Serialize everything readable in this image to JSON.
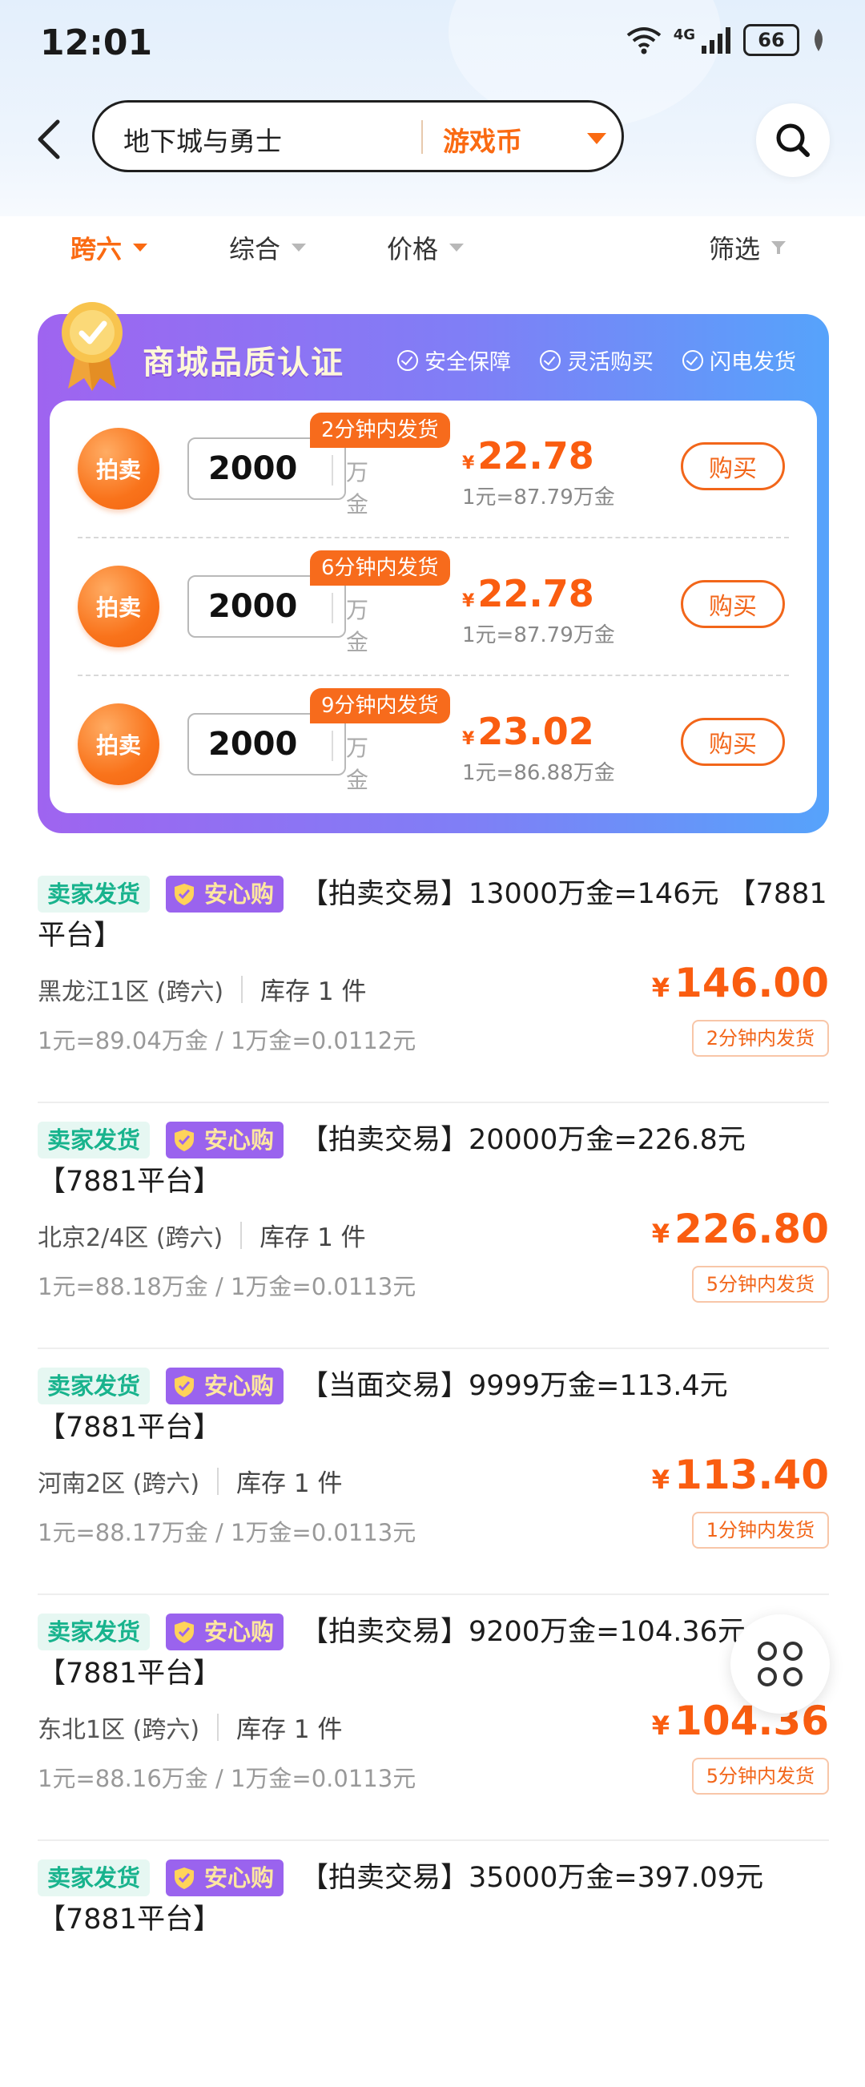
{
  "status_bar": {
    "time": "12:01",
    "network": "4G",
    "battery": "66"
  },
  "header": {
    "search_text": "地下城与勇士",
    "category": "游戏币"
  },
  "filters": [
    {
      "label": "跨六",
      "active": true
    },
    {
      "label": "综合",
      "active": false
    },
    {
      "label": "价格",
      "active": false
    },
    {
      "label": "筛选",
      "active": false
    }
  ],
  "quality": {
    "title": "商城品质认证",
    "features": [
      "安全保障",
      "灵活购买",
      "闪电发货"
    ],
    "offers": [
      {
        "badge": "拍卖",
        "quantity": "2000",
        "unit": "万金",
        "ship": "2分钟内发货",
        "yen": "¥",
        "price": "22.78",
        "rate": "1元=87.79万金",
        "buy": "购买"
      },
      {
        "badge": "拍卖",
        "quantity": "2000",
        "unit": "万金",
        "ship": "6分钟内发货",
        "yen": "¥",
        "price": "22.78",
        "rate": "1元=87.79万金",
        "buy": "购买"
      },
      {
        "badge": "拍卖",
        "quantity": "2000",
        "unit": "万金",
        "ship": "9分钟内发货",
        "yen": "¥",
        "price": "23.02",
        "rate": "1元=86.88万金",
        "buy": "购买"
      }
    ]
  },
  "listings": [
    {
      "tag_seller": "卖家发货",
      "tag_safe": "安心购",
      "title": "【拍卖交易】13000万金=146元 【7881平台】",
      "server": "黑龙江1区 (跨六)",
      "stock": "库存 1 件",
      "rate": "1元=89.04万金 / 1万金=0.0112元",
      "yen": "¥",
      "price": "146.00",
      "ship": "2分钟内发货"
    },
    {
      "tag_seller": "卖家发货",
      "tag_safe": "安心购",
      "title": "【拍卖交易】20000万金=226.8元 【7881平台】",
      "server": "北京2/4区 (跨六)",
      "stock": "库存 1 件",
      "rate": "1元=88.18万金 / 1万金=0.0113元",
      "yen": "¥",
      "price": "226.80",
      "ship": "5分钟内发货"
    },
    {
      "tag_seller": "卖家发货",
      "tag_safe": "安心购",
      "title": "【当面交易】9999万金=113.4元 【7881平台】",
      "server": "河南2区 (跨六)",
      "stock": "库存 1 件",
      "rate": "1元=88.17万金 / 1万金=0.0113元",
      "yen": "¥",
      "price": "113.40",
      "ship": "1分钟内发货"
    },
    {
      "tag_seller": "卖家发货",
      "tag_safe": "安心购",
      "title": "【拍卖交易】9200万金=104.36元 【7881平台】",
      "server": "东北1区 (跨六)",
      "stock": "库存 1 件",
      "rate": "1元=88.16万金 / 1万金=0.0113元",
      "yen": "¥",
      "price": "104.36",
      "ship": "5分钟内发货"
    },
    {
      "tag_seller": "卖家发货",
      "tag_safe": "安心购",
      "title": "【拍卖交易】35000万金=397.09元 【7881平台】"
    }
  ]
}
